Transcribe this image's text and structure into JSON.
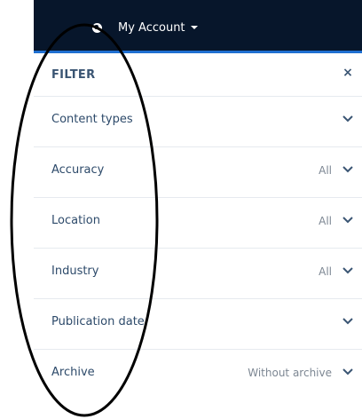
{
  "header": {
    "account_label": "My Account",
    "account_icon": "globe-icon",
    "caret_icon": "caret-down-icon",
    "background": "#07162b",
    "accent": "#1f6fd1"
  },
  "filter": {
    "title": "FILTER",
    "close_symbol": "×",
    "rows": [
      {
        "label": "Content types",
        "value": ""
      },
      {
        "label": "Accuracy",
        "value": "All"
      },
      {
        "label": "Location",
        "value": "All"
      },
      {
        "label": "Industry",
        "value": "All"
      },
      {
        "label": "Publication date",
        "value": ""
      },
      {
        "label": "Archive",
        "value": "Without archive"
      }
    ]
  }
}
